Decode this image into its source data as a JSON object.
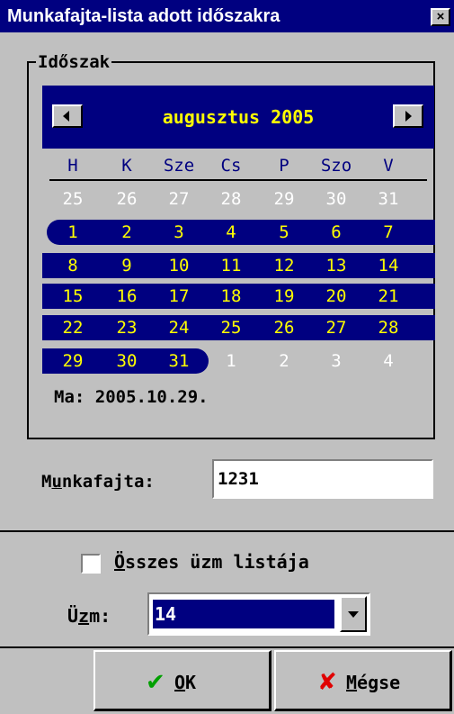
{
  "window": {
    "title": "Munkafajta-lista adott időszakra",
    "close_symbol": "×"
  },
  "period_group": {
    "label": "Időszak"
  },
  "calendar": {
    "month_label": "augusztus 2005",
    "weekdays": [
      "H",
      "K",
      "Sze",
      "Cs",
      "P",
      "Szo",
      "V"
    ],
    "weeks": [
      [
        "25",
        "26",
        "27",
        "28",
        "29",
        "30",
        "31"
      ],
      [
        "1",
        "2",
        "3",
        "4",
        "5",
        "6",
        "7"
      ],
      [
        "8",
        "9",
        "10",
        "11",
        "12",
        "13",
        "14"
      ],
      [
        "15",
        "16",
        "17",
        "18",
        "19",
        "20",
        "21"
      ],
      [
        "22",
        "23",
        "24",
        "25",
        "26",
        "27",
        "28"
      ],
      [
        "29",
        "30",
        "31",
        "1",
        "2",
        "3",
        "4"
      ]
    ],
    "today_text": "Ma: 2005.10.29.",
    "colors": {
      "band": "#000080",
      "selected_text": "#ffff00",
      "other_month_text": "#ffffff"
    }
  },
  "munkafajta": {
    "label_pre": "M",
    "label_accel": "u",
    "label_post": "nkafajta:",
    "value": "1231"
  },
  "all_checkbox": {
    "accel": "Ö",
    "label_rest": "sszes üzm listája",
    "checked": false
  },
  "uzm": {
    "label_pre": "Ü",
    "label_accel": "z",
    "label_post": "m:",
    "selected_value": "14"
  },
  "buttons": {
    "ok": {
      "icon": "checkmark-icon",
      "accel": "O",
      "rest": "K"
    },
    "cancel": {
      "icon": "x-icon",
      "accel": "M",
      "rest": "égse"
    }
  }
}
